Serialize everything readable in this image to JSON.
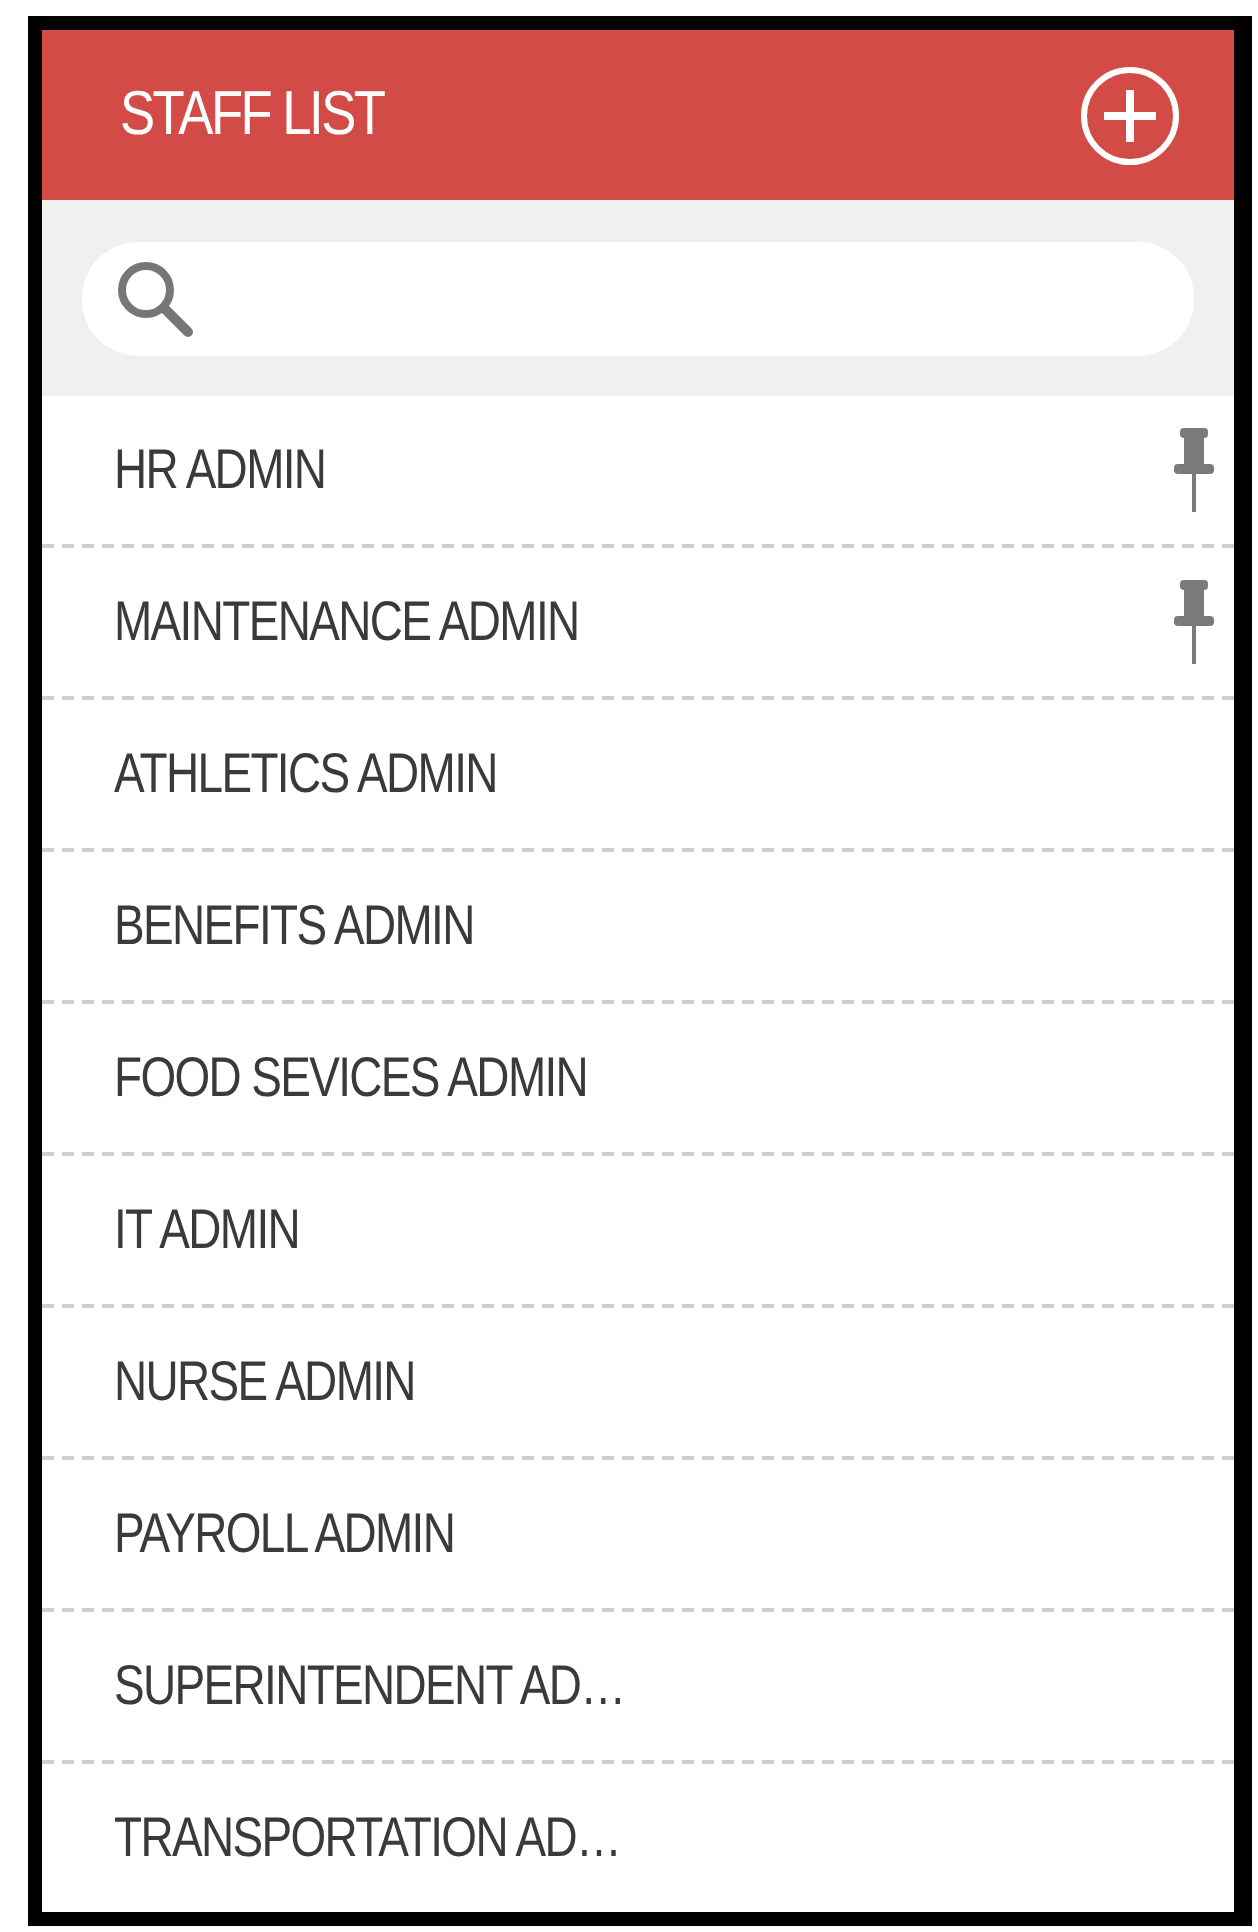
{
  "header": {
    "title": "STAFF LIST"
  },
  "staff": [
    {
      "name": "HR ADMIN",
      "pinned": true
    },
    {
      "name": "MAINTENANCE ADMIN",
      "pinned": true
    },
    {
      "name": "ATHLETICS ADMIN",
      "pinned": false
    },
    {
      "name": "BENEFITS ADMIN",
      "pinned": false
    },
    {
      "name": "FOOD SEVICES ADMIN",
      "pinned": false
    },
    {
      "name": "IT ADMIN",
      "pinned": false
    },
    {
      "name": "NURSE ADMIN",
      "pinned": false
    },
    {
      "name": "PAYROLL ADMIN",
      "pinned": false
    },
    {
      "name": "SUPERINTENDENT AD…",
      "pinned": false
    },
    {
      "name": "TRANSPORTATION AD…",
      "pinned": false
    }
  ]
}
